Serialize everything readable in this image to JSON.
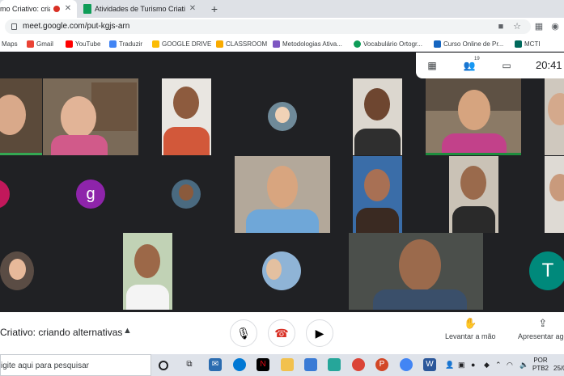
{
  "browser": {
    "tabs": [
      {
        "label": "mo Criativo: crian",
        "active": true,
        "recording": true
      },
      {
        "label": "Atividades de Turismo Criativo: c",
        "active": false
      }
    ],
    "new_tab": "+",
    "url": "meet.google.com/put-kgjs-arn",
    "bookmarks": [
      {
        "label": "Maps",
        "icon": "maps-icon",
        "color": "#34a853"
      },
      {
        "label": "Gmail",
        "icon": "gmail-icon",
        "color": "#ea4335"
      },
      {
        "label": "YouTube",
        "icon": "youtube-icon",
        "color": "#ff0000"
      },
      {
        "label": "Traduzir",
        "icon": "translate-icon",
        "color": "#4285f4"
      },
      {
        "label": "GOOGLE DRIVE",
        "icon": "drive-icon",
        "color": "#fbbc04"
      },
      {
        "label": "CLASSROOM",
        "icon": "classroom-icon",
        "color": "#f9ab00"
      },
      {
        "label": "Metodologias Ativa...",
        "icon": "bookmark-icon",
        "color": "#7e57c2"
      },
      {
        "label": "Vocabulário Ortogr...",
        "icon": "bookmark-icon",
        "color": "#0f9d58"
      },
      {
        "label": "Curso Online de Pr...",
        "icon": "bookmark-icon",
        "color": "#1565c0"
      },
      {
        "label": "MCTI",
        "icon": "bookmark-icon",
        "color": "#00695c"
      }
    ]
  },
  "meet": {
    "participant_count": "19",
    "time": "20:41",
    "avatar_letters": {
      "g": "g",
      "t": "T"
    },
    "meeting_title": "Criativo: criando alternativas",
    "raise_hand_label": "Levantar a mão",
    "present_label": "Apresentar ago"
  },
  "taskbar": {
    "search_placeholder": "igite aqui para pesquisar",
    "lang_top": "POR",
    "lang_bottom": "PTB2",
    "date": "25/0"
  },
  "colors": {
    "stage_bg": "#202124",
    "avatar_g": "#8e24aa",
    "avatar_t": "#00897b",
    "active_speaker": "#1e8e3e",
    "end_call": "#d93025"
  }
}
